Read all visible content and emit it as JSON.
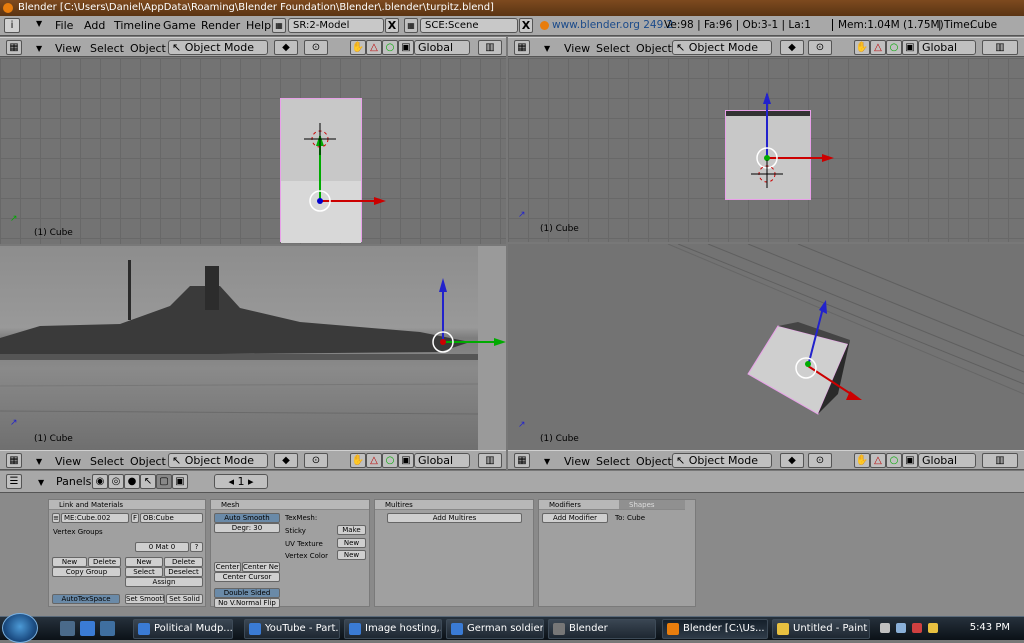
{
  "window": {
    "title": "Blender [C:\\Users\\Daniel\\AppData\\Roaming\\Blender Foundation\\Blender\\.blender\\turpitz.blend]"
  },
  "menubar": {
    "menu": [
      "File",
      "Add",
      "Timeline",
      "Game",
      "Render",
      "Help"
    ],
    "screen": "SR:2-Model",
    "scene": "SCE:Scene",
    "close": "X",
    "url": "www.blender.org 249.2",
    "stats": "Ve:98 | Fa:96 | Ob:3-1 | La:1",
    "mem": "Mem:1.04M (1.75M)",
    "time": "Time:",
    "object": "Cube"
  },
  "viewport": {
    "menus": [
      "View",
      "Select",
      "Object"
    ],
    "mode": "Object Mode",
    "orientation": "Global",
    "label": "(1) Cube"
  },
  "buttons": {
    "panels_label": "Panels",
    "frame": "1",
    "link": {
      "header": "Link and Materials",
      "mesh_name": "ME:Cube.002",
      "f_flag": "F",
      "ob_name": "OB:Cube",
      "vertex_groups": "Vertex Groups",
      "mat_counter": "0 Mat 0",
      "mat_q": "?",
      "new": "New",
      "delete": "Delete",
      "copy_group": "Copy Group",
      "select": "Select",
      "deselect": "Deselect",
      "assign": "Assign",
      "autotexspace": "AutoTexSpace",
      "set_smooth": "Set Smooth",
      "set_solid": "Set Solid"
    },
    "mesh": {
      "header": "Mesh",
      "auto_smooth": "Auto Smooth",
      "degr": "Degr: 30",
      "texmesh": "TexMesh:",
      "sticky": "Sticky",
      "make": "Make",
      "uv_texture": "UV Texture",
      "new": "New",
      "vertex_color": "Vertex Color",
      "center": "Center",
      "center_new": "Center New",
      "center_cursor": "Center Cursor",
      "double_sided": "Double Sided",
      "no_v_normal_flip": "No V.Normal Flip"
    },
    "multires": {
      "header": "Multires",
      "add": "Add Multires"
    },
    "modifiers": {
      "header": "Modifiers",
      "tab_shapes": "Shapes",
      "add": "Add Modifier",
      "to": "To: Cube"
    }
  },
  "taskbar": {
    "items": [
      {
        "label": "Political Mudp...",
        "color": "#3a7bd5"
      },
      {
        "label": "YouTube - Part...",
        "color": "#3a7bd5"
      },
      {
        "label": "Image hosting,...",
        "color": "#3a7bd5"
      },
      {
        "label": "German soldier...",
        "color": "#3a7bd5"
      },
      {
        "label": "Blender",
        "color": "#777777"
      },
      {
        "label": "Blender [C:\\Us...",
        "color": "#e87d0d"
      },
      {
        "label": "Untitled - Paint",
        "color": "#e8c040"
      }
    ],
    "clock": "5:43 PM"
  }
}
